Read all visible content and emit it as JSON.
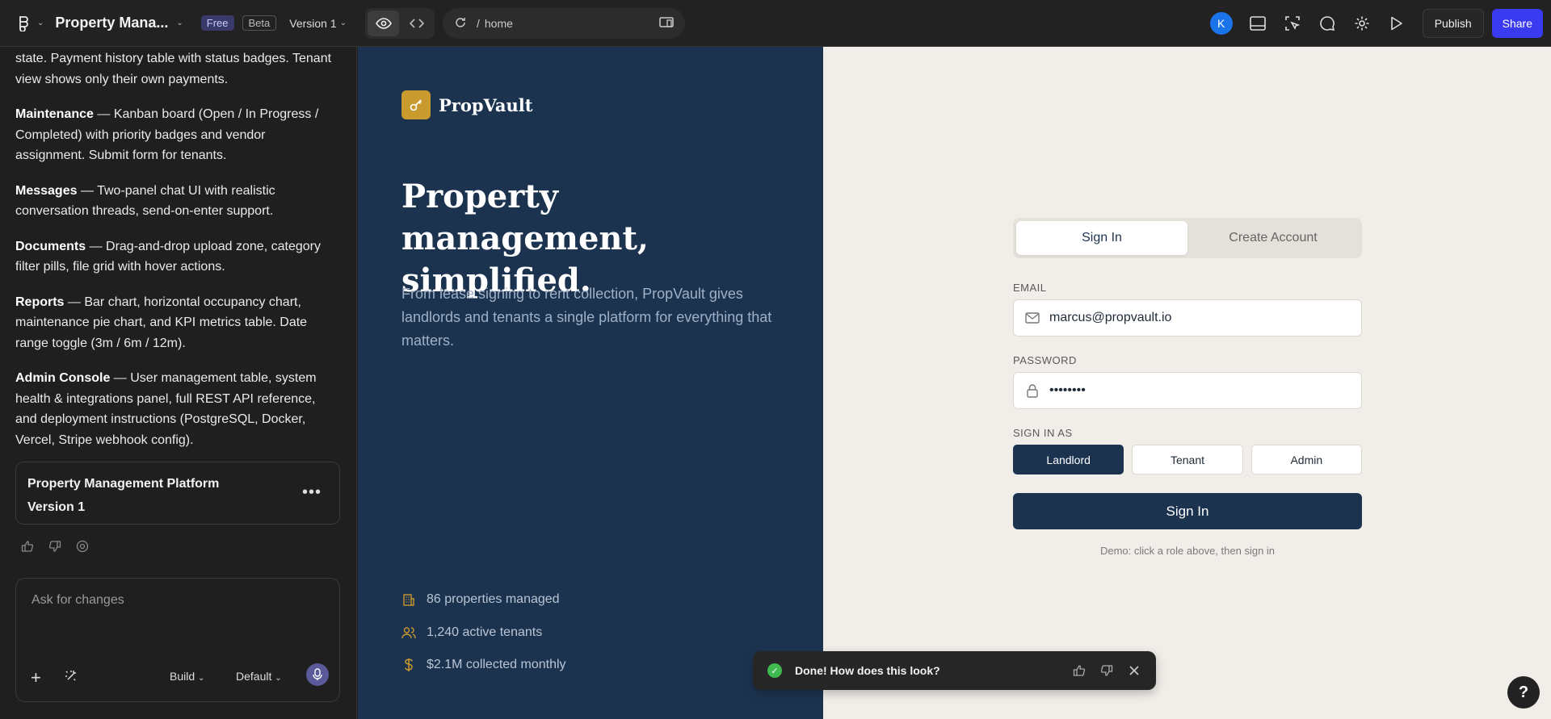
{
  "header": {
    "project_name": "Property Mana...",
    "badge_free": "Free",
    "badge_beta": "Beta",
    "version": "Version 1",
    "url_sep": "/",
    "url_path": "home",
    "avatar_letter": "K",
    "publish": "Publish",
    "share": "Share"
  },
  "chat": {
    "lead": "state. Payment history table with status badges. Tenant view shows only their own payments.",
    "items": [
      {
        "title": "Maintenance",
        "body": " — Kanban board (Open / In Progress / Completed) with priority badges and vendor assignment. Submit form for tenants."
      },
      {
        "title": "Messages",
        "body": " — Two-panel chat UI with realistic conversation threads, send-on-enter support."
      },
      {
        "title": "Documents",
        "body": " — Drag-and-drop upload zone, category filter pills, file grid with hover actions."
      },
      {
        "title": "Reports",
        "body": " — Bar chart, horizontal occupancy chart, maintenance pie chart, and KPI metrics table. Date range toggle (3m / 6m / 12m)."
      },
      {
        "title": "Admin Console",
        "body": " — User management table, system health & integrations panel, full REST API reference, and deployment instructions (PostgreSQL, Docker, Vercel, Stripe webhook config)."
      }
    ],
    "version_card": {
      "title": "Property Management Platform",
      "subtitle": "Version 1"
    },
    "composer": {
      "placeholder": "Ask for changes",
      "mode": "Build",
      "model": "Default"
    }
  },
  "app": {
    "brand": "PropVault",
    "hero_title": "Property management, simplified.",
    "hero_sub": "From lease signing to rent collection, PropVault gives landlords and tenants a single platform for everything that matters.",
    "stats": [
      "86 properties managed",
      "1,240 active tenants",
      "$2.1M collected monthly"
    ],
    "tabs": [
      "Sign In",
      "Create Account"
    ],
    "email_label": "EMAIL",
    "email_value": "marcus@propvault.io",
    "password_label": "PASSWORD",
    "password_value": "••••••••",
    "role_label": "SIGN IN AS",
    "roles": [
      "Landlord",
      "Tenant",
      "Admin"
    ],
    "submit": "Sign In",
    "demo_note": "Demo: click a role above, then sign in"
  },
  "toast": {
    "text": "Done! How does this look?"
  },
  "help": "?",
  "colors": {
    "navy": "#1c3350",
    "gold": "#c99a2e",
    "beige": "#f1eee9",
    "share_blue": "#3a3af0"
  }
}
